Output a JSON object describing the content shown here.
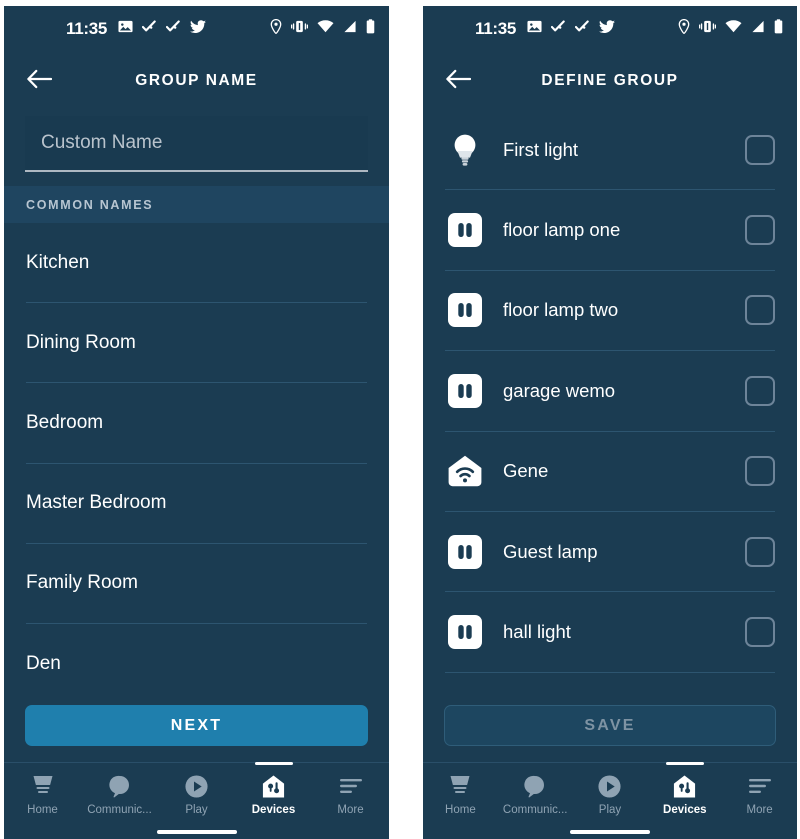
{
  "colors": {
    "background": "#1b3c52",
    "field_background": "#193a50",
    "section_band": "#1f4560",
    "divider": "#2d5570",
    "primary_button": "#1f7fad",
    "disabled_button": "#1d4660",
    "text_primary": "#ffffff",
    "text_muted": "#8fa3b3",
    "checkbox_border": "#6d8499"
  },
  "status_bar": {
    "clock": "11:35",
    "left_icons": [
      "image-icon",
      "check-activity-icon",
      "check-activity-icon",
      "twitter-icon"
    ],
    "right_icons": [
      "location-pin-icon",
      "vibrate-icon",
      "wifi-icon",
      "cell-signal-icon",
      "battery-icon"
    ]
  },
  "left_screen": {
    "header": {
      "back_icon": "back-arrow-icon",
      "title": "GROUP NAME"
    },
    "custom_name_field": {
      "placeholder": "Custom Name",
      "value": ""
    },
    "section_header": "COMMON NAMES",
    "common_names": [
      {
        "label": "Kitchen"
      },
      {
        "label": "Dining Room"
      },
      {
        "label": "Bedroom"
      },
      {
        "label": "Master Bedroom"
      },
      {
        "label": "Family Room"
      },
      {
        "label": "Den"
      }
    ],
    "cta": {
      "label": "NEXT",
      "enabled": true
    }
  },
  "right_screen": {
    "header": {
      "back_icon": "back-arrow-icon",
      "title": "DEFINE GROUP"
    },
    "devices": [
      {
        "label": "First light",
        "icon": "lightbulb-icon",
        "checked": false
      },
      {
        "label": "floor lamp one",
        "icon": "smart-plug-icon",
        "checked": false
      },
      {
        "label": "floor lamp two",
        "icon": "smart-plug-icon",
        "checked": false
      },
      {
        "label": "garage wemo",
        "icon": "smart-plug-icon",
        "checked": false
      },
      {
        "label": "Gene",
        "icon": "home-hub-wifi-icon",
        "checked": false
      },
      {
        "label": "Guest lamp",
        "icon": "smart-plug-icon",
        "checked": false
      },
      {
        "label": "hall light",
        "icon": "smart-plug-icon",
        "checked": false
      }
    ],
    "cta": {
      "label": "SAVE",
      "enabled": false
    }
  },
  "bottom_nav": {
    "items": [
      {
        "label": "Home",
        "icon": "echo-device-icon",
        "active": false
      },
      {
        "label": "Communic...",
        "icon": "speech-bubble-icon",
        "active": false
      },
      {
        "label": "Play",
        "icon": "play-circle-icon",
        "active": false
      },
      {
        "label": "Devices",
        "icon": "devices-home-icon",
        "active": true
      },
      {
        "label": "More",
        "icon": "hamburger-icon",
        "active": false
      }
    ]
  }
}
